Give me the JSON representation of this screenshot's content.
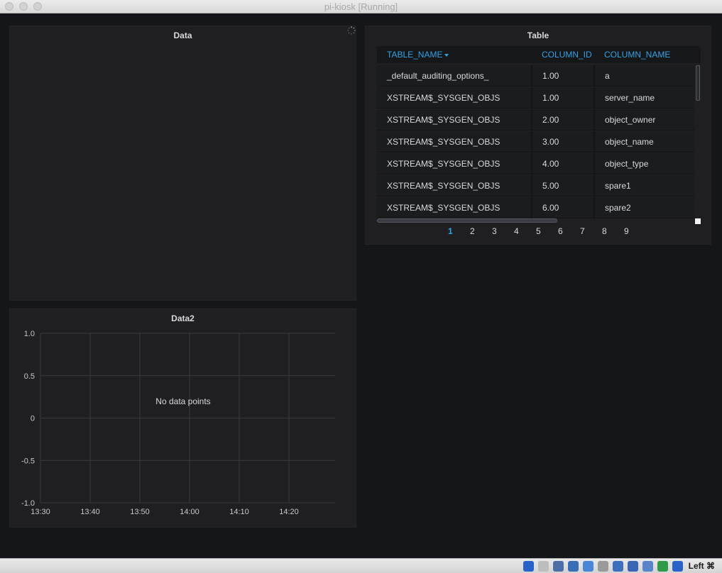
{
  "window": {
    "title": "pi-kiosk [Running]"
  },
  "panels": {
    "data": {
      "title": "Data"
    },
    "table": {
      "title": "Table"
    },
    "data2": {
      "title": "Data2"
    }
  },
  "table": {
    "columns": [
      "TABLE_NAME",
      "COLUMN_ID",
      "COLUMN_NAME"
    ],
    "sorted_column": "TABLE_NAME",
    "rows": [
      [
        "_default_auditing_options_",
        "1.00",
        "a"
      ],
      [
        "XSTREAM$_SYSGEN_OBJS",
        "1.00",
        "server_name"
      ],
      [
        "XSTREAM$_SYSGEN_OBJS",
        "2.00",
        "object_owner"
      ],
      [
        "XSTREAM$_SYSGEN_OBJS",
        "3.00",
        "object_name"
      ],
      [
        "XSTREAM$_SYSGEN_OBJS",
        "4.00",
        "object_type"
      ],
      [
        "XSTREAM$_SYSGEN_OBJS",
        "5.00",
        "spare1"
      ],
      [
        "XSTREAM$_SYSGEN_OBJS",
        "6.00",
        "spare2"
      ]
    ],
    "pages": [
      "1",
      "2",
      "3",
      "4",
      "5",
      "6",
      "7",
      "8",
      "9"
    ],
    "current_page": "1"
  },
  "chart_data": {
    "type": "line",
    "title": "Data2",
    "x_ticks": [
      "13:30",
      "13:40",
      "13:50",
      "14:00",
      "14:10",
      "14:20"
    ],
    "y_ticks": [
      "1.0",
      "0.5",
      "0",
      "-0.5",
      "-1.0"
    ],
    "ylim": [
      -1.0,
      1.0
    ],
    "grid": true,
    "series": [],
    "message": "No data points"
  },
  "statusbar": {
    "host_key": "Left ⌘",
    "icons": [
      "hard-disk-icon",
      "optical-drive-icon",
      "audio-icon",
      "network-icon",
      "usb-icon",
      "shared-folders-icon",
      "display-icon",
      "video-capture-icon",
      "cpu-icon",
      "mouse-integration-icon",
      "download-icon"
    ]
  },
  "colors": {
    "accent": "#33a2e5",
    "panel_bg": "#1f1f21",
    "page_bg": "#141619",
    "text": "#d8d9da"
  }
}
